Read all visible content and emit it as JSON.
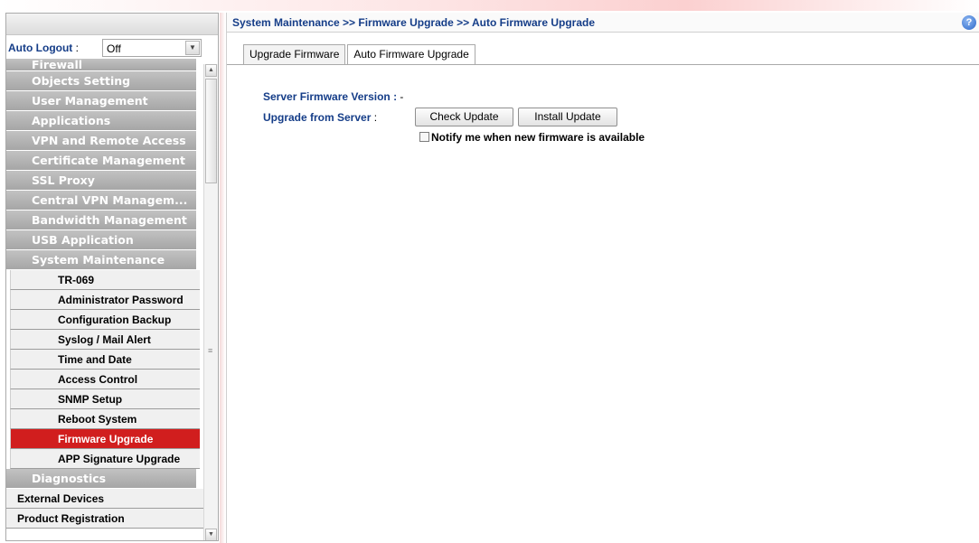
{
  "auto_logout": {
    "label": "Auto Logout",
    "colon": " : ",
    "value": "Off"
  },
  "menu": {
    "categories_top": [
      "Firewall",
      "Objects Setting",
      "User Management",
      "Applications",
      "VPN and Remote Access",
      "Certificate Management",
      "SSL Proxy",
      "Central VPN Managem...",
      "Bandwidth Management",
      "USB Application",
      "System Maintenance"
    ],
    "system_maintenance_items": [
      "TR-069",
      "Administrator Password",
      "Configuration Backup",
      "Syslog / Mail Alert",
      "Time and Date",
      "Access Control",
      "SNMP Setup",
      "Reboot System",
      "Firmware Upgrade",
      "APP Signature Upgrade"
    ],
    "active_item": "Firmware Upgrade",
    "category_after": "Diagnostics",
    "plain_items": [
      "External Devices",
      "Product Registration"
    ]
  },
  "breadcrumb": "System Maintenance >> Firmware Upgrade >> Auto Firmware Upgrade",
  "help_icon": "?",
  "tabs": [
    {
      "label": "Upgrade Firmware",
      "active": false
    },
    {
      "label": "Auto Firmware Upgrade",
      "active": true
    }
  ],
  "form": {
    "server_version_label": "Server Firmware Version",
    "server_version_colon": " : ",
    "server_version_value": "-",
    "upgrade_from_label": "Upgrade from Server",
    "upgrade_from_colon": " :",
    "check_update": "Check Update",
    "install_update": "Install Update",
    "notify_label": "Notify me when new firmware is available",
    "notify_checked": false
  },
  "colors": {
    "active_menu": "#d11e1e",
    "link_blue": "#153d88",
    "category_gray": "#a6a6a6"
  }
}
